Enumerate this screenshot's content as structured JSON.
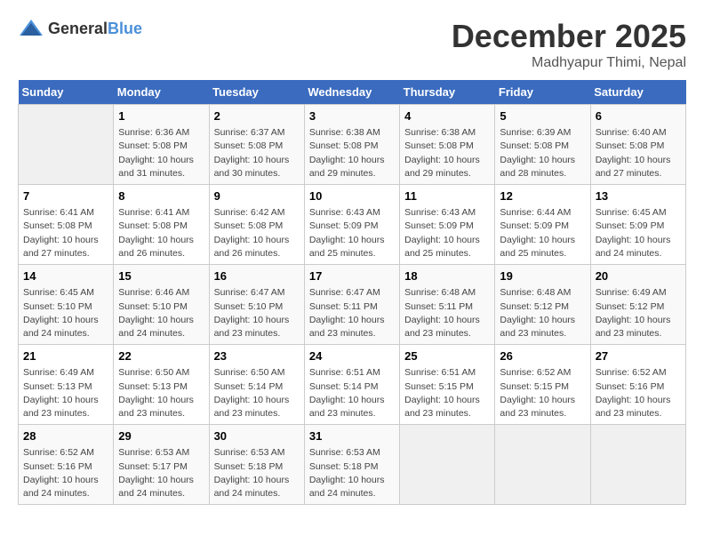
{
  "header": {
    "logo_general": "General",
    "logo_blue": "Blue",
    "title": "December 2025",
    "subtitle": "Madhyapur Thimi, Nepal"
  },
  "days_of_week": [
    "Sunday",
    "Monday",
    "Tuesday",
    "Wednesday",
    "Thursday",
    "Friday",
    "Saturday"
  ],
  "weeks": [
    [
      {
        "day": "",
        "info": ""
      },
      {
        "day": "1",
        "info": "Sunrise: 6:36 AM\nSunset: 5:08 PM\nDaylight: 10 hours\nand 31 minutes."
      },
      {
        "day": "2",
        "info": "Sunrise: 6:37 AM\nSunset: 5:08 PM\nDaylight: 10 hours\nand 30 minutes."
      },
      {
        "day": "3",
        "info": "Sunrise: 6:38 AM\nSunset: 5:08 PM\nDaylight: 10 hours\nand 29 minutes."
      },
      {
        "day": "4",
        "info": "Sunrise: 6:38 AM\nSunset: 5:08 PM\nDaylight: 10 hours\nand 29 minutes."
      },
      {
        "day": "5",
        "info": "Sunrise: 6:39 AM\nSunset: 5:08 PM\nDaylight: 10 hours\nand 28 minutes."
      },
      {
        "day": "6",
        "info": "Sunrise: 6:40 AM\nSunset: 5:08 PM\nDaylight: 10 hours\nand 27 minutes."
      }
    ],
    [
      {
        "day": "7",
        "info": "Sunrise: 6:41 AM\nSunset: 5:08 PM\nDaylight: 10 hours\nand 27 minutes."
      },
      {
        "day": "8",
        "info": "Sunrise: 6:41 AM\nSunset: 5:08 PM\nDaylight: 10 hours\nand 26 minutes."
      },
      {
        "day": "9",
        "info": "Sunrise: 6:42 AM\nSunset: 5:08 PM\nDaylight: 10 hours\nand 26 minutes."
      },
      {
        "day": "10",
        "info": "Sunrise: 6:43 AM\nSunset: 5:09 PM\nDaylight: 10 hours\nand 25 minutes."
      },
      {
        "day": "11",
        "info": "Sunrise: 6:43 AM\nSunset: 5:09 PM\nDaylight: 10 hours\nand 25 minutes."
      },
      {
        "day": "12",
        "info": "Sunrise: 6:44 AM\nSunset: 5:09 PM\nDaylight: 10 hours\nand 25 minutes."
      },
      {
        "day": "13",
        "info": "Sunrise: 6:45 AM\nSunset: 5:09 PM\nDaylight: 10 hours\nand 24 minutes."
      }
    ],
    [
      {
        "day": "14",
        "info": "Sunrise: 6:45 AM\nSunset: 5:10 PM\nDaylight: 10 hours\nand 24 minutes."
      },
      {
        "day": "15",
        "info": "Sunrise: 6:46 AM\nSunset: 5:10 PM\nDaylight: 10 hours\nand 24 minutes."
      },
      {
        "day": "16",
        "info": "Sunrise: 6:47 AM\nSunset: 5:10 PM\nDaylight: 10 hours\nand 23 minutes."
      },
      {
        "day": "17",
        "info": "Sunrise: 6:47 AM\nSunset: 5:11 PM\nDaylight: 10 hours\nand 23 minutes."
      },
      {
        "day": "18",
        "info": "Sunrise: 6:48 AM\nSunset: 5:11 PM\nDaylight: 10 hours\nand 23 minutes."
      },
      {
        "day": "19",
        "info": "Sunrise: 6:48 AM\nSunset: 5:12 PM\nDaylight: 10 hours\nand 23 minutes."
      },
      {
        "day": "20",
        "info": "Sunrise: 6:49 AM\nSunset: 5:12 PM\nDaylight: 10 hours\nand 23 minutes."
      }
    ],
    [
      {
        "day": "21",
        "info": "Sunrise: 6:49 AM\nSunset: 5:13 PM\nDaylight: 10 hours\nand 23 minutes."
      },
      {
        "day": "22",
        "info": "Sunrise: 6:50 AM\nSunset: 5:13 PM\nDaylight: 10 hours\nand 23 minutes."
      },
      {
        "day": "23",
        "info": "Sunrise: 6:50 AM\nSunset: 5:14 PM\nDaylight: 10 hours\nand 23 minutes."
      },
      {
        "day": "24",
        "info": "Sunrise: 6:51 AM\nSunset: 5:14 PM\nDaylight: 10 hours\nand 23 minutes."
      },
      {
        "day": "25",
        "info": "Sunrise: 6:51 AM\nSunset: 5:15 PM\nDaylight: 10 hours\nand 23 minutes."
      },
      {
        "day": "26",
        "info": "Sunrise: 6:52 AM\nSunset: 5:15 PM\nDaylight: 10 hours\nand 23 minutes."
      },
      {
        "day": "27",
        "info": "Sunrise: 6:52 AM\nSunset: 5:16 PM\nDaylight: 10 hours\nand 23 minutes."
      }
    ],
    [
      {
        "day": "28",
        "info": "Sunrise: 6:52 AM\nSunset: 5:16 PM\nDaylight: 10 hours\nand 24 minutes."
      },
      {
        "day": "29",
        "info": "Sunrise: 6:53 AM\nSunset: 5:17 PM\nDaylight: 10 hours\nand 24 minutes."
      },
      {
        "day": "30",
        "info": "Sunrise: 6:53 AM\nSunset: 5:18 PM\nDaylight: 10 hours\nand 24 minutes."
      },
      {
        "day": "31",
        "info": "Sunrise: 6:53 AM\nSunset: 5:18 PM\nDaylight: 10 hours\nand 24 minutes."
      },
      {
        "day": "",
        "info": ""
      },
      {
        "day": "",
        "info": ""
      },
      {
        "day": "",
        "info": ""
      }
    ]
  ]
}
